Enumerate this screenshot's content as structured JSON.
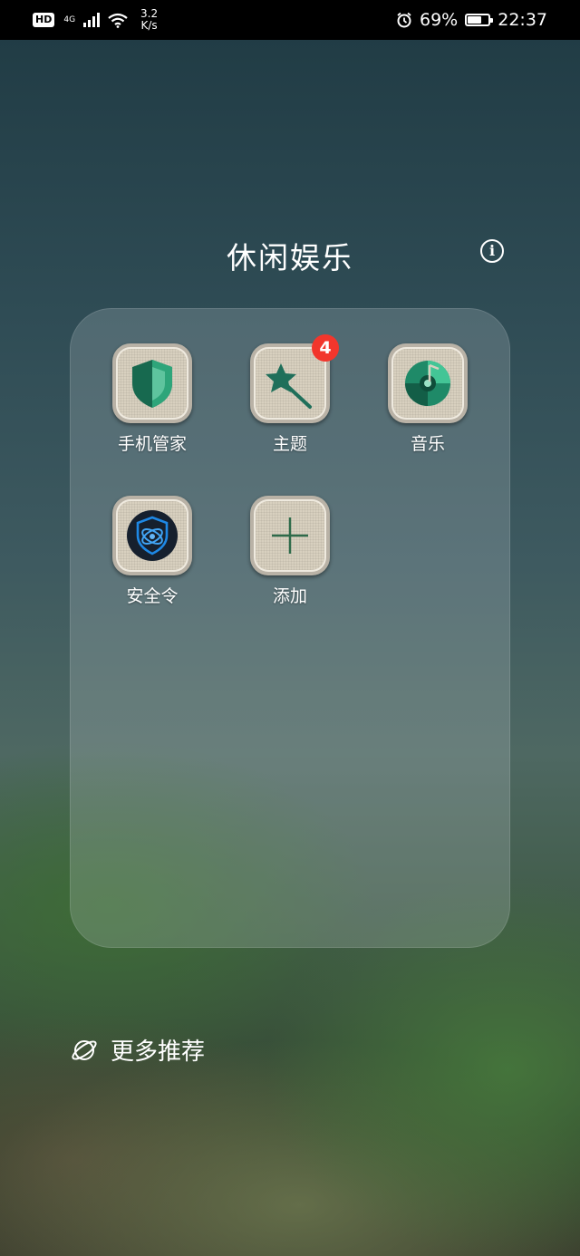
{
  "status_bar": {
    "hd": "HD",
    "network": "4G",
    "speed_value": "3.2",
    "speed_unit": "K/s",
    "battery_percent": "69%",
    "battery_level": 0.69,
    "time": "22:37",
    "icons": [
      "signal-icon",
      "wifi-icon",
      "alarm-icon",
      "battery-icon"
    ]
  },
  "folder": {
    "title": "休闲娱乐",
    "apps": [
      {
        "label": "手机管家",
        "icon": "shield-icon"
      },
      {
        "label": "主题",
        "icon": "magic-wand-star-icon",
        "badge": "4"
      },
      {
        "label": "音乐",
        "icon": "music-disc-icon"
      },
      {
        "label": "安全令",
        "icon": "security-token-icon"
      },
      {
        "label": "添加",
        "icon": "plus-icon"
      }
    ]
  },
  "more": {
    "label": "更多推荐",
    "icon": "planet-icon"
  },
  "colors": {
    "badge": "#f2362c",
    "icon_green": "#1f7a5c",
    "token_blue": "#1e88e5"
  }
}
